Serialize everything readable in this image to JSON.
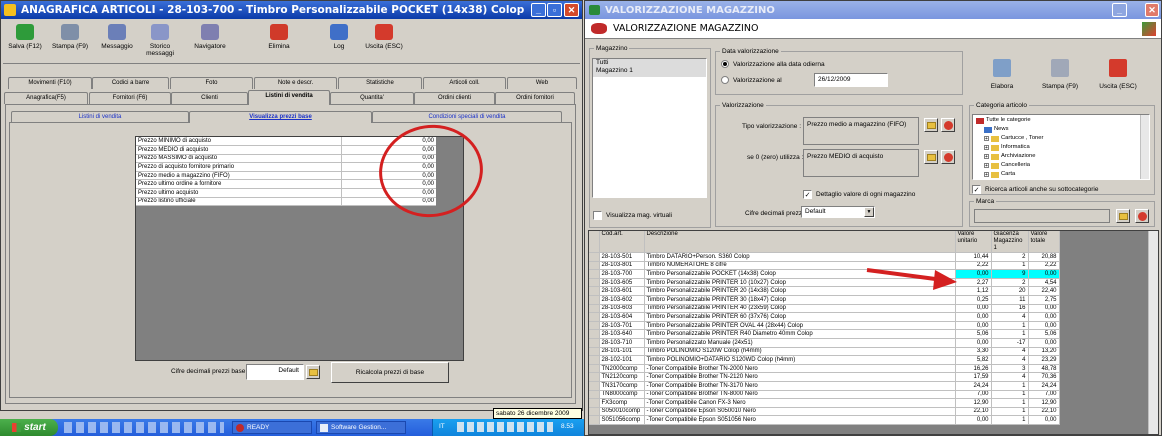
{
  "left_window": {
    "title": "ANAGRAFICA ARTICOLI - 28-103-700 - Timbro Personalizzabile POCKET (14x38) Colop",
    "toolbar": [
      {
        "label": "Salva (F12)",
        "icon": "check-icon",
        "color": "#2e9b3a"
      },
      {
        "label": "Stampa (F9)",
        "icon": "printer-icon",
        "color": "#7f8fa8"
      },
      {
        "label": "Messaggio",
        "icon": "pencil-icon",
        "color": "#6b7fb8"
      },
      {
        "label": "Storico messaggi",
        "icon": "message-icon",
        "color": "#8a96c8"
      },
      {
        "label": "Navigatore",
        "icon": "navigator-icon",
        "color": "#7f7fb0"
      },
      {
        "label": "Elimina",
        "icon": "delete-icon",
        "color": "#d03a2a"
      },
      {
        "label": "Log",
        "icon": "log-icon",
        "color": "#3f6fc8"
      },
      {
        "label": "Uscita (ESC)",
        "icon": "exit-icon",
        "color": "#d43a2c"
      }
    ],
    "tabs_row1": [
      "Movimenti (F10)",
      "Codici a barre",
      "Foto",
      "Note e descr.",
      "Statistiche",
      "Articoli coll.",
      "Web"
    ],
    "tabs_row2": [
      "Anagrafica(F5)",
      "Fornitori (F6)",
      "Clienti",
      "Listini di vendita",
      "Quantita'",
      "Ordini clienti",
      "Ordini fornitori"
    ],
    "subtabs": [
      "Listini di vendita",
      "Visualizza prezzi base",
      "Condizioni speciali di vendita"
    ],
    "price_rows": [
      {
        "label": "Prezzo MINIMO di acquisto",
        "value": "0,00"
      },
      {
        "label": "Prezzo MEDIO di acquisto",
        "value": "0,00"
      },
      {
        "label": "Prezzo MASSIMO di acquisto",
        "value": "0,00"
      },
      {
        "label": "Prezzo di acquisto fornitore primario",
        "value": "0,00"
      },
      {
        "label": "Prezzo medio a magazzino (FIFO)",
        "value": "0,00"
      },
      {
        "label": "Prezzo ultimo ordine a fornitore",
        "value": "0,00"
      },
      {
        "label": "Prezzo ultimo acquisto",
        "value": "0,00"
      },
      {
        "label": "Prezzo listino ufficiale",
        "value": "0,00"
      }
    ],
    "decimals_label": "Cifre decimali prezzi base :",
    "decimals_value": "Default",
    "recalc_button": "Ricalcola prezzi di base"
  },
  "right_window": {
    "title": "VALORIZZAZIONE MAGAZZINO",
    "header_title": "VALORIZZAZIONE MAGAZZINO",
    "magazzino_label": "Magazzino",
    "magazzino_items": [
      "Tutti",
      "Magazzino 1"
    ],
    "virtual_checkbox": "Visualizza mag. virtuali",
    "data_val_label": "Data valorizzazione",
    "radio_today": "Valorizzazione alla data odierna",
    "radio_at": "Valorizzazione al",
    "date_value": "26/12/2009",
    "actions": [
      {
        "label": "Elabora",
        "icon": "process-icon"
      },
      {
        "label": "Stampa (F9)",
        "icon": "printer-icon"
      },
      {
        "label": "Uscita (ESC)",
        "icon": "exit-icon"
      }
    ],
    "valorizzazione_label": "Valorizzazione",
    "tipo_label": "Tipo valorizzazione :",
    "tipo_value": "Prezzo medio a magazzino (FIFO)",
    "zero_label": "se 0 (zero) utilizza :",
    "zero_value": "Prezzo MEDIO di acquisto",
    "detail_checkbox": "Dettaglio valore di ogni magazzino",
    "decimals_label": "Cifre decimali prezzi :",
    "decimals_value": "Default",
    "categoria_label": "Categoria articolo",
    "categories": [
      "Tutte le categorie",
      "News",
      "Cartucce , Toner",
      "Informatica",
      "Archiviazione",
      "Cancelleria",
      "Carta"
    ],
    "sub_cat_checkbox": "Ricerca articoli anche su sottocategorie",
    "marca_label": "Marca",
    "grid_headers": [
      "Cod.art.",
      "Descrizione",
      "Valore unitario",
      "Giacenza Magazzino 1",
      "Valore totale"
    ],
    "rows": [
      [
        "28-103-501",
        "Timbro DATARIO+Person. S360 Colop",
        "10,44",
        "2",
        "20,88"
      ],
      [
        "28-103-801",
        "Timbro NUMERATORE 8 cifre",
        "2,22",
        "1",
        "2,22"
      ],
      [
        "28-103-700",
        "Timbro Personalizzabile POCKET (14x38) Colop",
        "0,00",
        "9",
        "0,00"
      ],
      [
        "28-103-605",
        "Timbro Personalizzabile PRINTER 10 (10x27) Colop",
        "2,27",
        "2",
        "4,54"
      ],
      [
        "28-103-601",
        "Timbro Personalizzabile PRINTER 20 (14x38) Colop",
        "1,12",
        "20",
        "22,40"
      ],
      [
        "28-103-602",
        "Timbro Personalizzabile PRINTER 30 (18x47) Colop",
        "0,25",
        "11",
        "2,75"
      ],
      [
        "28-103-603",
        "Timbro Personalizzabile PRINTER 40 (23x59) Colop",
        "0,00",
        "16",
        "0,00"
      ],
      [
        "28-103-604",
        "Timbro Personalizzabile PRINTER 60 (37x76) Colop",
        "0,00",
        "4",
        "0,00"
      ],
      [
        "28-103-701",
        "Timbro Personalizzabile PRINTER OVAL 44 (28x44) Colop",
        "0,00",
        "1",
        "0,00"
      ],
      [
        "28-103-640",
        "Timbro Personalizzabile PRINTER R40 Diametro 40mm Colop",
        "5,06",
        "1",
        "5,06"
      ],
      [
        "28-103-710",
        "Timbro Personalizzato Manuale (24x51)",
        "0,00",
        "-17",
        "0,00"
      ],
      [
        "28-101-101",
        "Timbro POLINOMIO S120W Colop (h4mm)",
        "3,30",
        "4",
        "13,20"
      ],
      [
        "28-102-101",
        "Timbro POLINOMIO+DATARIO S120WD Colop (h4mm)",
        "5,82",
        "4",
        "23,29"
      ],
      [
        "TN2000comp",
        "-Toner Compatibile Brother TN-2000 Nero",
        "16,26",
        "3",
        "48,78"
      ],
      [
        "TN2120comp",
        "-Toner Compatibile Brother TN-2120 Nero",
        "17,59",
        "4",
        "70,36"
      ],
      [
        "TN3170comp",
        "-Toner Compatibile Brother TN-3170 Nero",
        "24,24",
        "1",
        "24,24"
      ],
      [
        "TN8000comp",
        "-Toner Compatibile Brother TN-8000 Nero",
        "7,00",
        "1",
        "7,00"
      ],
      [
        "FX3comp",
        "-Toner Compatibile Canon FX-3 Nero",
        "12,90",
        "1",
        "12,90"
      ],
      [
        "S050010comp",
        "-Toner Compatibile Epson S050010 Nero",
        "22,10",
        "1",
        "22,10"
      ],
      [
        "S051056comp",
        "-Toner Compatibile Epson S051056 Nero",
        "0,00",
        "1",
        "0,00"
      ]
    ],
    "highlight_row": 2
  },
  "taskbar": {
    "start": "start",
    "tasks": [
      "READY",
      "Software Gestion..."
    ],
    "lang": "IT",
    "clock": "8.53",
    "tooltip": "sabato 26 dicembre 2009"
  },
  "colors": {
    "titlebar_active": "#0a246a",
    "titlebar_inactive": "#7a96df",
    "highlight_row": "#00ffff",
    "annotation_red": "#d42020",
    "xp_taskbar": "#245edb",
    "xp_start": "#3c9a3c"
  }
}
